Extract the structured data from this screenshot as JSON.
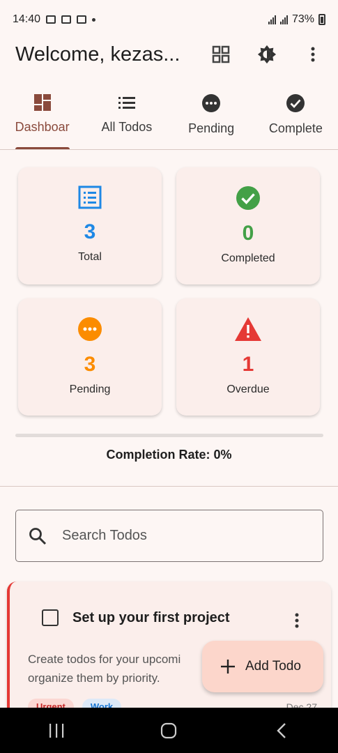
{
  "status_bar": {
    "time": "14:40",
    "battery": "73%"
  },
  "app_bar": {
    "title": "Welcome, kezas..."
  },
  "tabs": [
    {
      "label": "Dashboar",
      "icon": "dashboard-icon",
      "active": true
    },
    {
      "label": "All Todos",
      "icon": "list-icon",
      "active": false
    },
    {
      "label": "Pending",
      "icon": "pending-icon",
      "active": false
    },
    {
      "label": "Complete",
      "icon": "check-circle-icon",
      "active": false
    }
  ],
  "stats": {
    "total": {
      "value": "3",
      "label": "Total",
      "color": "#1e88e5"
    },
    "completed": {
      "value": "0",
      "label": "Completed",
      "color": "#43a047"
    },
    "pending": {
      "value": "3",
      "label": "Pending",
      "color": "#fb8c00"
    },
    "overdue": {
      "value": "1",
      "label": "Overdue",
      "color": "#e53935"
    }
  },
  "completion": {
    "label": "Completion Rate: 0%",
    "progress_fraction": 0
  },
  "search": {
    "placeholder": "Search Todos"
  },
  "todo": {
    "title": "Set up your first project",
    "description_line1": "Create todos for your upcomi",
    "description_line2": "organize them by priority.",
    "tags": [
      "Urgent",
      "Work"
    ],
    "date": "Dec 27"
  },
  "fab": {
    "label": "Add Todo"
  },
  "colors": {
    "accent": "#8a4a3c",
    "background": "#fdf6f4",
    "card": "#fbeeeb",
    "fab": "#fcd6cb"
  }
}
